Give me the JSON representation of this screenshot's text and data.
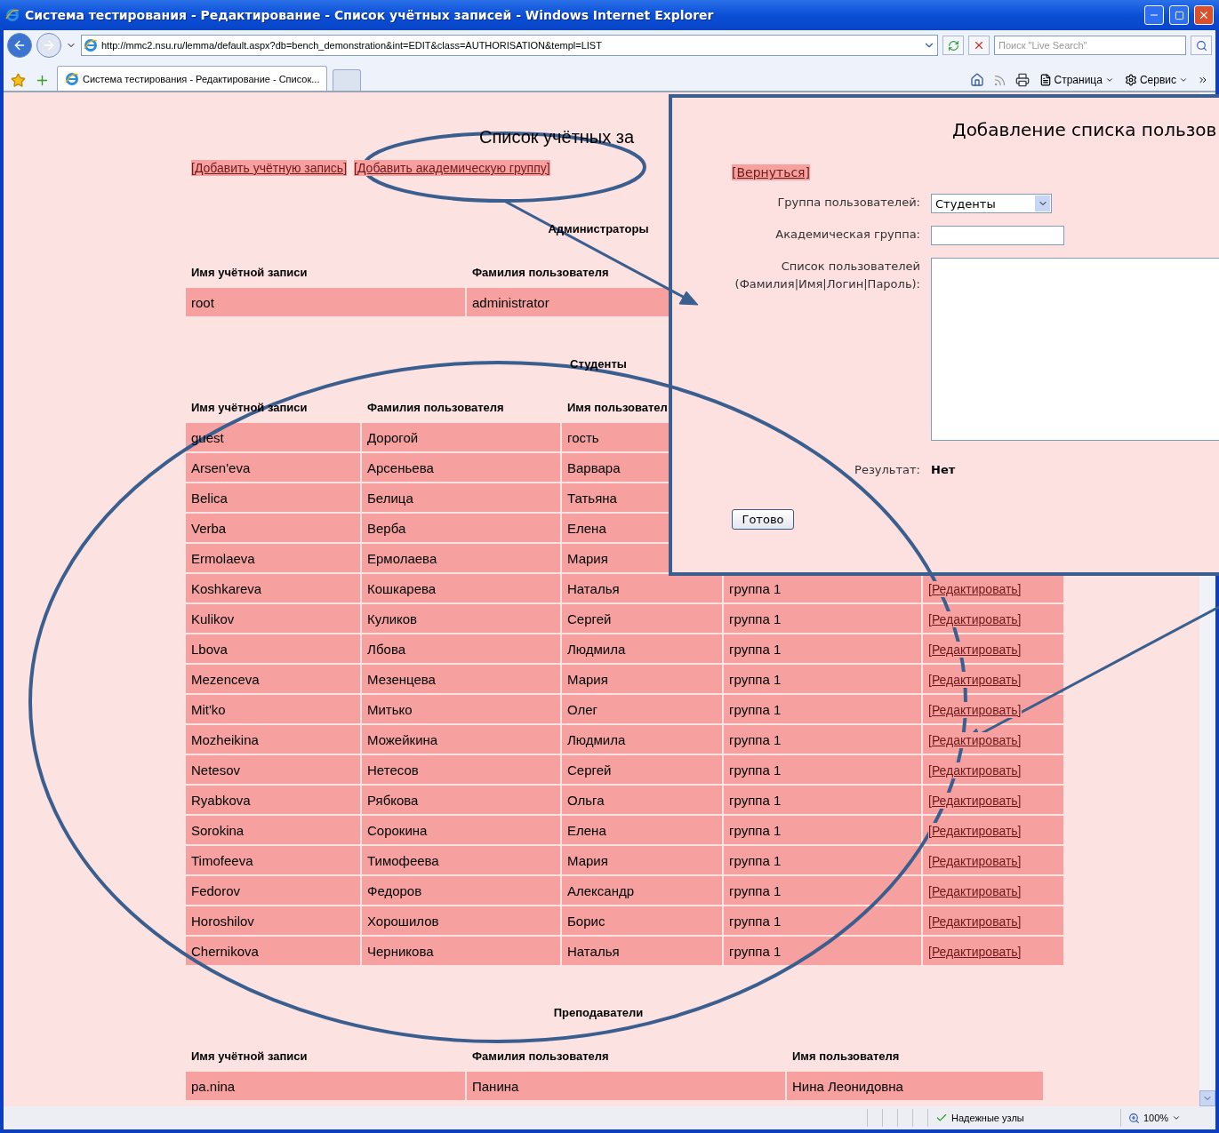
{
  "window": {
    "title": "Система тестирования - Редактирование - Список учётных записей - Windows Internet Explorer"
  },
  "address_bar": {
    "url": "http://mmc2.nsu.ru/lemma/default.aspx?db=bench_demonstration&int=EDIT&class=AUTHORISATION&templ=LIST"
  },
  "search": {
    "placeholder": "Поиск \"Live Search\""
  },
  "tabs": [
    {
      "label": "Система тестирования - Редактирование - Список...",
      "selected": true
    }
  ],
  "command_bar": [
    "Страница",
    "Сервис"
  ],
  "page": {
    "title": "Список учётных за",
    "links": [
      "[Добавить учётную запись]",
      "[Добавить академическую группу]"
    ],
    "sections": [
      {
        "kind": "admins",
        "heading": "Администраторы",
        "columns": [
          "Имя учётной записи",
          "Фамилия пользователя"
        ],
        "rows": [
          {
            "cells": [
              "root",
              "administrator"
            ]
          }
        ]
      },
      {
        "kind": "students",
        "heading": "Студенты",
        "columns": [
          "Имя учётной записи",
          "Фамилия пользователя",
          "Имя пользовател"
        ],
        "rows": [
          {
            "cells": [
              "guest",
              "Дорогой",
              "гость"
            ]
          },
          {
            "cells": [
              "Arsen'eva",
              "Арсеньева",
              "Варвара"
            ]
          },
          {
            "cells": [
              "Belica",
              "Белица",
              "Татьяна"
            ]
          },
          {
            "cells": [
              "Verba",
              "Верба",
              "Елена"
            ]
          },
          {
            "cells": [
              "Ermolaeva",
              "Ермолаева",
              "Мария"
            ]
          },
          {
            "cells": [
              "Koshkareva",
              "Кошкарева",
              "Наталья",
              "группа 1"
            ],
            "action": "[Редактировать]"
          },
          {
            "cells": [
              "Kulikov",
              "Куликов",
              "Сергей",
              "группа 1"
            ],
            "action": "[Редактировать]"
          },
          {
            "cells": [
              "Lbova",
              "Лбова",
              "Людмила",
              "группа 1"
            ],
            "action": "[Редактировать]"
          },
          {
            "cells": [
              "Mezenceva",
              "Мезенцева",
              "Мария",
              "группа 1"
            ],
            "action": "[Редактировать]"
          },
          {
            "cells": [
              "Mit'ko",
              "Митько",
              "Олег",
              "группа 1"
            ],
            "action": "[Редактировать]"
          },
          {
            "cells": [
              "Mozheikina",
              "Можейкина",
              "Людмила",
              "группа 1"
            ],
            "action": "[Редактировать]"
          },
          {
            "cells": [
              "Netesov",
              "Нетесов",
              "Сергей",
              "группа 1"
            ],
            "action": "[Редактировать]"
          },
          {
            "cells": [
              "Ryabkova",
              "Рябкова",
              "Ольга",
              "группа 1"
            ],
            "action": "[Редактировать]"
          },
          {
            "cells": [
              "Sorokina",
              "Сорокина",
              "Елена",
              "группа 1"
            ],
            "action": "[Редактировать]"
          },
          {
            "cells": [
              "Timofeeva",
              "Тимофеева",
              "Мария",
              "группа 1"
            ],
            "action": "[Редактировать]"
          },
          {
            "cells": [
              "Fedorov",
              "Федоров",
              "Александр",
              "группа 1"
            ],
            "action": "[Редактировать]"
          },
          {
            "cells": [
              "Horoshilov",
              "Хорошилов",
              "Борис",
              "группа 1"
            ],
            "action": "[Редактировать]"
          },
          {
            "cells": [
              "Chernikova",
              "Черникова",
              "Наталья",
              "группа 1"
            ],
            "action": "[Редактировать]"
          }
        ]
      },
      {
        "kind": "teachers",
        "heading": "Преподаватели",
        "columns": [
          "Имя учётной записи",
          "Фамилия пользователя",
          "Имя пользователя"
        ],
        "rows": [
          {
            "cells": [
              "pa.nina",
              "Панина",
              "Нина Леонидовна"
            ]
          }
        ]
      }
    ]
  },
  "dialog": {
    "title": "Добавление списка пользов",
    "back_link": "[Вернуться]",
    "fields": [
      {
        "kind": "select",
        "label": "Группа пользователей:",
        "value": "Студенты"
      },
      {
        "kind": "input",
        "label": "Академическая группа:"
      },
      {
        "kind": "textarea",
        "label": "Список пользователей\n(Фамилия|Имя|Логин|Пароль):"
      }
    ],
    "result": {
      "label": "Результат:",
      "value": "Нет"
    },
    "submit": "Готово"
  },
  "status_bar": {
    "zone": "Надежные узлы",
    "zoom": "100%"
  }
}
